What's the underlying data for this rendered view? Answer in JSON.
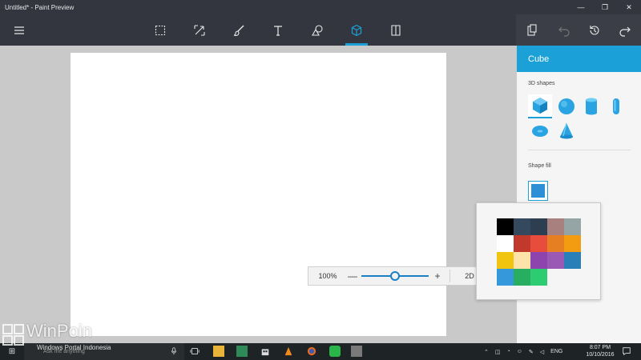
{
  "window": {
    "title": "Untitled* - Paint Preview",
    "minimize_glyph": "—",
    "maximize_glyph": "❐",
    "close_glyph": "✕"
  },
  "toolbar": {
    "tools": [
      {
        "name": "menu",
        "icon": "hamburger-icon"
      },
      {
        "name": "select",
        "icon": "select-icon"
      },
      {
        "name": "crop",
        "icon": "crop-icon"
      },
      {
        "name": "brushes",
        "icon": "brush-icon"
      },
      {
        "name": "text",
        "icon": "text-icon"
      },
      {
        "name": "2d-shapes",
        "icon": "shapes-icon"
      },
      {
        "name": "3d-objects",
        "icon": "cube-icon",
        "active": true
      },
      {
        "name": "stickers",
        "icon": "sticker-icon"
      },
      {
        "name": "paste",
        "icon": "paste-icon"
      },
      {
        "name": "undo",
        "icon": "undo-icon",
        "disabled": true
      },
      {
        "name": "history",
        "icon": "history-icon"
      },
      {
        "name": "redo",
        "icon": "redo-icon"
      }
    ],
    "accent": "#1ba1d8"
  },
  "zoom": {
    "percent": "100%",
    "mode": "2D",
    "level": 0.5
  },
  "panel": {
    "title": "Cube",
    "shapes_label": "3D shapes",
    "shapes": [
      "cube-icon",
      "sphere-icon",
      "cylinder-icon",
      "capsule-icon",
      "donut-icon",
      "cone-icon"
    ],
    "selected_shape": "cube-icon",
    "fill_label": "Shape fill",
    "fill_color": "#2d8fd6"
  },
  "palette": {
    "colors": [
      "#000000",
      "#34495e",
      "#2c3e50",
      "#a8817f",
      "#95a5a6",
      "#ffffff",
      "#c0392b",
      "#e74c3c",
      "#e67e22",
      "#f39c12",
      "#f1c40f",
      "#fde3a7",
      "#8e44ad",
      "#9b59b6",
      "#2980b9",
      "#3498db",
      "#27ae60",
      "#2ecc71"
    ]
  },
  "taskbar": {
    "search_placeholder": "Ask me anything",
    "language": "ENG",
    "time": "8:07 PM",
    "date": "10/10/2016"
  },
  "watermark": {
    "title": "WinPoin",
    "subtitle": "Windows Portal Indonesia"
  }
}
